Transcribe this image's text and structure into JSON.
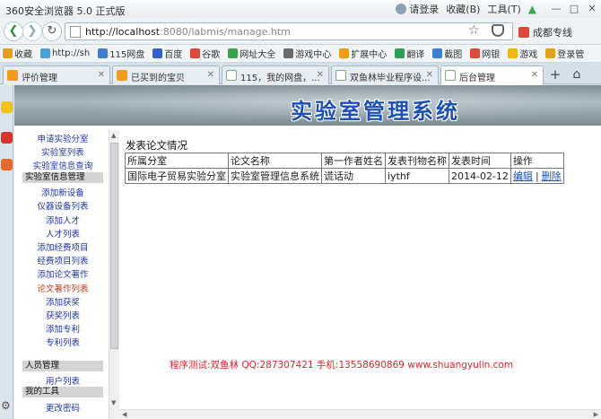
{
  "browser": {
    "title": "360安全浏览器 5.0 正式版",
    "login": "请登录",
    "favorites_menu": "收藏(B)",
    "tools_menu": "工具(T)",
    "url_host": "http://localhost",
    "url_rest": ":8080/labmis/manage.htm",
    "weather": "成都专线"
  },
  "bookmarks": [
    {
      "label": "收藏",
      "color": "#e3a11b"
    },
    {
      "label": "http://sh",
      "color": "#4aa0d8"
    },
    {
      "label": "115网盘",
      "color": "#3a7fd0"
    },
    {
      "label": "百度",
      "color": "#2f5fc8"
    },
    {
      "label": "谷歌",
      "color": "#d94a38"
    },
    {
      "label": "网址大全",
      "color": "#39a34a"
    },
    {
      "label": "游戏中心",
      "color": "#6a6a6a"
    },
    {
      "label": "扩展中心",
      "color": "#f09b1b"
    },
    {
      "label": "翻译",
      "color": "#2e9e55"
    },
    {
      "label": "截图",
      "color": "#3a7fd0"
    },
    {
      "label": "网银",
      "color": "#d94a38"
    },
    {
      "label": "游戏",
      "color": "#f0b41b"
    },
    {
      "label": "登录管",
      "color": "#e3a11b"
    }
  ],
  "tabs": [
    {
      "label": "评价管理"
    },
    {
      "label": "已买到的宝贝"
    },
    {
      "label": "115，我的网盘，..."
    },
    {
      "label": "双鱼林毕业程序设..."
    },
    {
      "label": "后台管理"
    }
  ],
  "header": {
    "title": "实验室管理系统"
  },
  "nav": {
    "items_group1": [
      "申请实验分室",
      "实验室列表",
      "实验室信息查询"
    ],
    "section_lab": "实验室信息管理",
    "items_group2": [
      "添加新设备",
      "仪器设备列表",
      "添加人才",
      "人才列表",
      "添加经费项目",
      "经费项目列表",
      "添加论文著作",
      "论文著作列表",
      "添加获奖",
      "获奖列表",
      "添加专利",
      "专利列表"
    ],
    "active_item": "论文著作列表",
    "section_people": "人员管理",
    "items_group3": [
      "用户列表"
    ],
    "section_tools": "我的工具",
    "items_group4": [
      "更改密码"
    ]
  },
  "main": {
    "title": "发表论文情况",
    "columns": [
      "所属分室",
      "论文名称",
      "第一作者姓名",
      "发表刊物名称",
      "发表时间",
      "操作"
    ],
    "rows": [
      {
        "division": "国际电子贸易实验分室",
        "paper": "实验室管理信息系统",
        "author": "谎话动",
        "journal": "iythf",
        "date": "2014-02-12",
        "edit": "编辑",
        "sep": "|",
        "delete": "删除"
      }
    ],
    "credit": "程序测试:双鱼林 QQ:287307421 手机:13558690869 www.shuangyulin.com"
  }
}
